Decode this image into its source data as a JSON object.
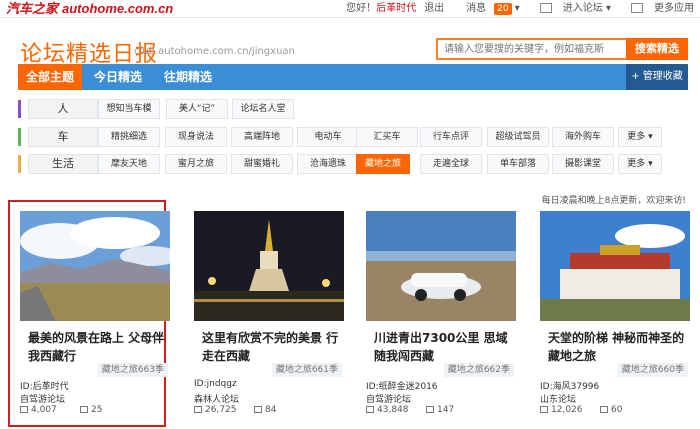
{
  "topbar": {
    "brand_cn": "汽车之家",
    "brand_en": "autohome.com.cn",
    "greeting": "您好！",
    "username": "后革时代",
    "logout": "退出",
    "messages": "消息",
    "message_count": "20",
    "enter_forum": "进入论坛",
    "more_apps": "更多应用"
  },
  "header": {
    "title": "论坛精选日报",
    "url": "club.autohome.com.cn/jingxuan",
    "search_placeholder": "请输入您要搜的关键字，例如福克斯",
    "search_button": "搜索精选"
  },
  "nav": {
    "tabs": [
      "全部主题",
      "今日精选",
      "往期精选"
    ],
    "manage": "管理收藏"
  },
  "categories": [
    {
      "label": "人",
      "tags": [
        "想知当车模",
        "美人“记”",
        "论坛名人堂"
      ],
      "color": "#8a4fc7"
    },
    {
      "label": "车",
      "tags": [
        "精挑细选",
        "现身说法",
        "高端阵地",
        "电动车",
        "汇买车",
        "行车点评",
        "超级试驾员",
        "海外购车"
      ],
      "more": "更多",
      "color": "#5cb85c"
    },
    {
      "label": "生活",
      "tags": [
        "摩友天地",
        "蜜月之旅",
        "甜蜜婚礼",
        "沧海遗珠",
        "藏地之旅",
        "走遍全球",
        "单车部落",
        "摄影课堂"
      ],
      "more": "更多",
      "active": "藏地之旅",
      "color": "#f0ad4e"
    }
  ],
  "notice": "每日凌晨和晚上8点更新，欢迎来访!",
  "cards": [
    {
      "title": "最美的风景在路上 父母伴我西藏行",
      "theme": "藏地之旅663季",
      "uid": "ID:后革时代",
      "forum": "自驾游论坛",
      "views": "4,007",
      "replies": "25"
    },
    {
      "title": "这里有欣赏不完的美景 行走在西藏",
      "theme": "藏地之旅661季",
      "uid": "ID:jndqgz",
      "forum": "森林人论坛",
      "views": "26,725",
      "replies": "84"
    },
    {
      "title": "川进青出7300公里 思域随我闯西藏",
      "theme": "藏地之旅662季",
      "uid": "ID:纸醉金迷2016",
      "forum": "自驾游论坛",
      "views": "43,848",
      "replies": "147"
    },
    {
      "title": "天堂的阶梯 神秘而神圣的藏地之旅",
      "theme": "藏地之旅660季",
      "uid": "ID:海风37996",
      "forum": "山东论坛",
      "views": "12,026",
      "replies": "60"
    }
  ],
  "colors": {
    "accent": "#ff6600",
    "nav_blue": "#3a8ed6",
    "highlight_frame": "#d01f1f"
  }
}
